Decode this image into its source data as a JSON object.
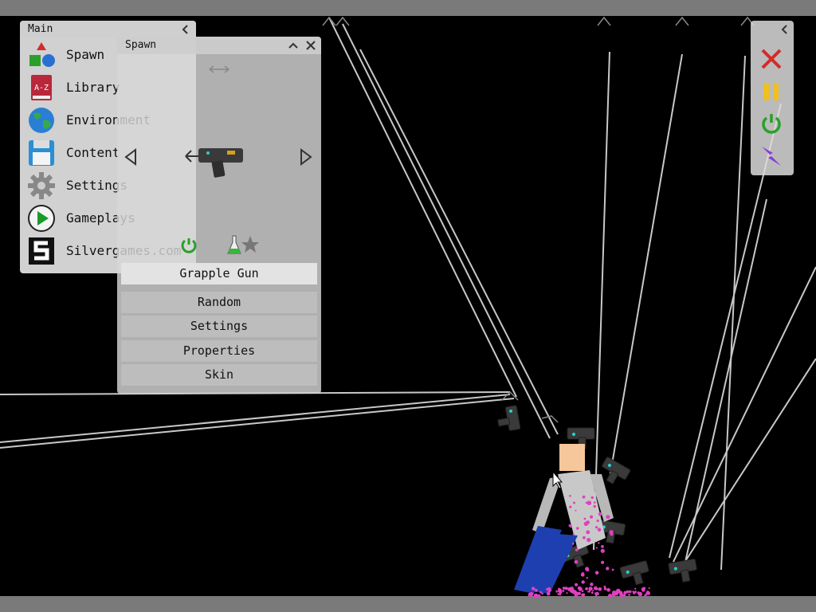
{
  "main_panel": {
    "title": "Main",
    "items": [
      {
        "label": "Spawn"
      },
      {
        "label": "Library"
      },
      {
        "label": "Environment"
      },
      {
        "label": "Content"
      },
      {
        "label": "Settings"
      },
      {
        "label": "Gameplays"
      },
      {
        "label": "Silvergames.com"
      }
    ]
  },
  "spawn_panel": {
    "title": "Spawn",
    "selected_item": "Grapple Gun",
    "options": [
      {
        "label": "Random"
      },
      {
        "label": "Settings"
      },
      {
        "label": "Properties"
      },
      {
        "label": "Skin"
      }
    ]
  },
  "toolbar": {
    "tools": [
      "close-icon",
      "pause-icon",
      "power-icon",
      "lightning-icon"
    ]
  },
  "colors": {
    "red": "#d42a2a",
    "yellow": "#f0c020",
    "green": "#2aa02a",
    "purple": "#8a3adf",
    "pink": "#e040c0"
  }
}
